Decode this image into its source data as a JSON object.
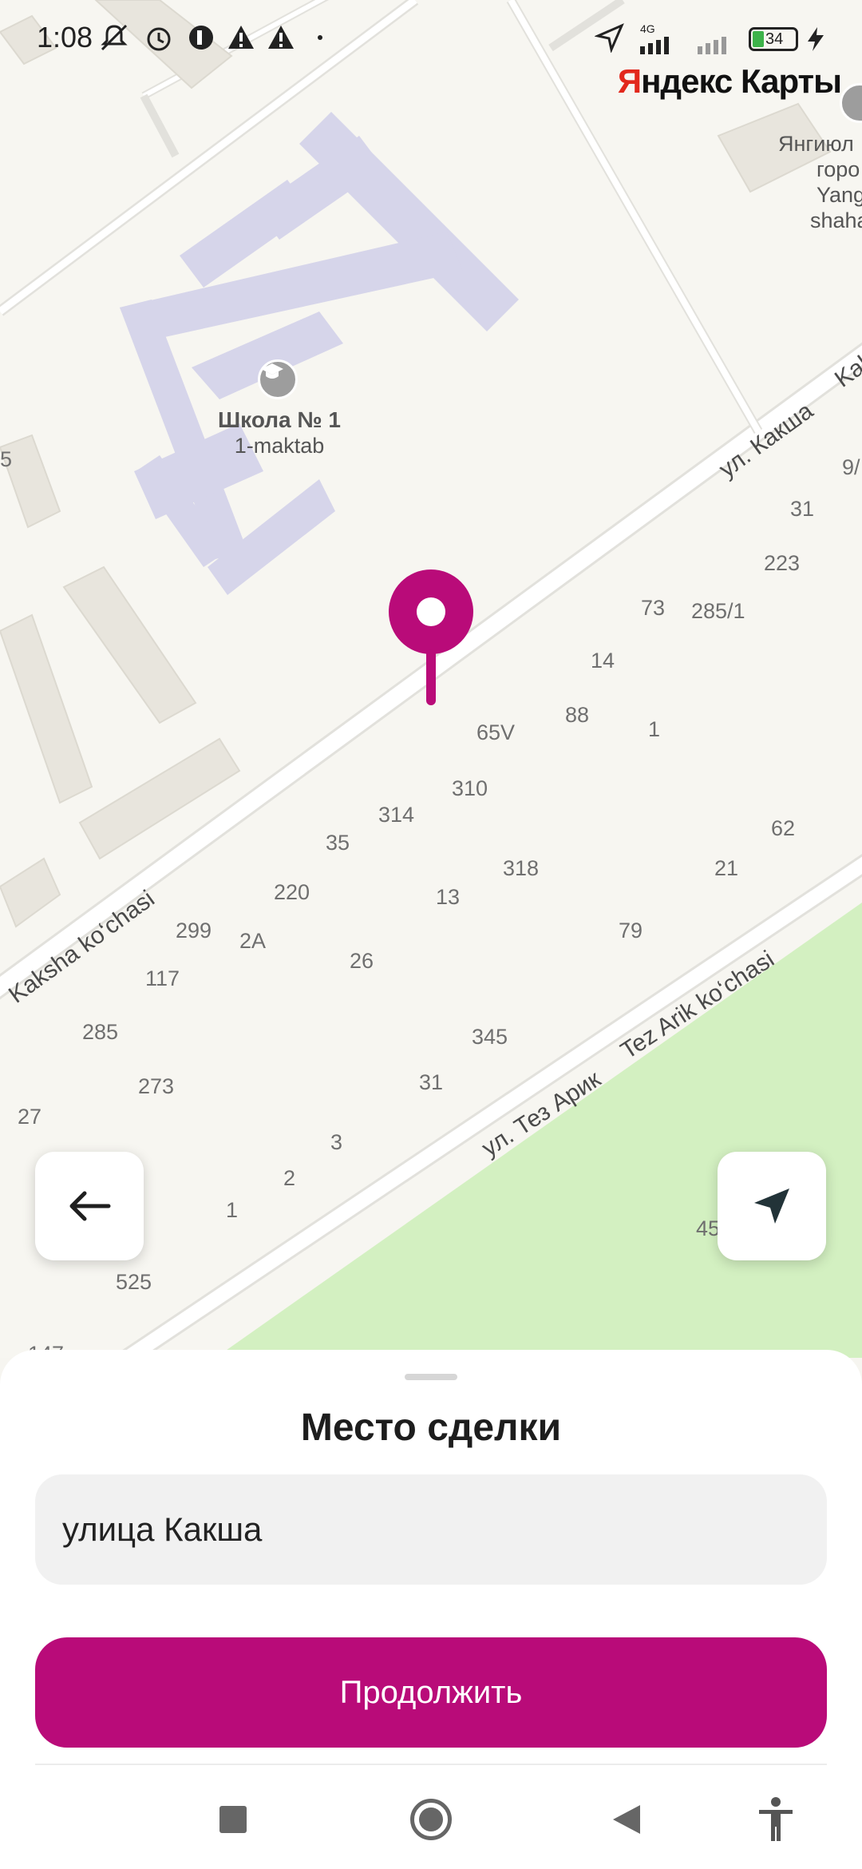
{
  "status_bar": {
    "time": "1:08",
    "network": "4G",
    "battery": "34"
  },
  "map": {
    "provider_logo": {
      "y": "Я",
      "rest": "ндекс Карты"
    },
    "poi": {
      "name": "Школа № 1",
      "subtitle": "1-maktab"
    },
    "right_poi": {
      "line1": "Янгиюл",
      "line2": "горо",
      "line3": "Yang",
      "line4": "shaha"
    },
    "streets": {
      "kaksha_ru": "ул. Какша",
      "kaksha_top_right": "Kak",
      "kaksha_uz": "Kaksha ko‘chasi",
      "tez_arik_ru": "ул. Тез Арик",
      "tez_arik_uz": "Tez Arik ko‘chasi"
    },
    "house_numbers": {
      "n1": "9/",
      "n2": "31",
      "n3": "223",
      "n4": "73",
      "n5": "285/1",
      "n6": "14",
      "n7": "88",
      "n8": "1",
      "n9": "65V",
      "n10": "310",
      "n11": "314",
      "n12": "62",
      "n13": "35",
      "n14": "318",
      "n15": "21",
      "n16": "220",
      "n17": "13",
      "n18": "299",
      "n19": "2A",
      "n20": "79",
      "n21": "26",
      "n22": "117",
      "n23": "285",
      "n24": "345",
      "n25": "273",
      "n26": "31",
      "n27": "27",
      "n28": "3",
      "n29": "2",
      "n30": "1",
      "n31": "45",
      "n32": "525",
      "n33": "5",
      "n34": "147"
    },
    "colors": {
      "pin": "#b90b79",
      "park": "#d3f0c1",
      "building_highlight": "#d6d5ea"
    }
  },
  "controls": {
    "back_icon": "arrow-left-icon",
    "locate_icon": "navigation-arrow-icon"
  },
  "sheet": {
    "title": "Место сделки",
    "address_value": "улица Какша",
    "continue_label": "Продолжить",
    "accent": "#b90b79"
  },
  "nav_bar": {
    "items": [
      "recent-apps-icon",
      "home-icon",
      "back-icon",
      "accessibility-icon"
    ]
  }
}
